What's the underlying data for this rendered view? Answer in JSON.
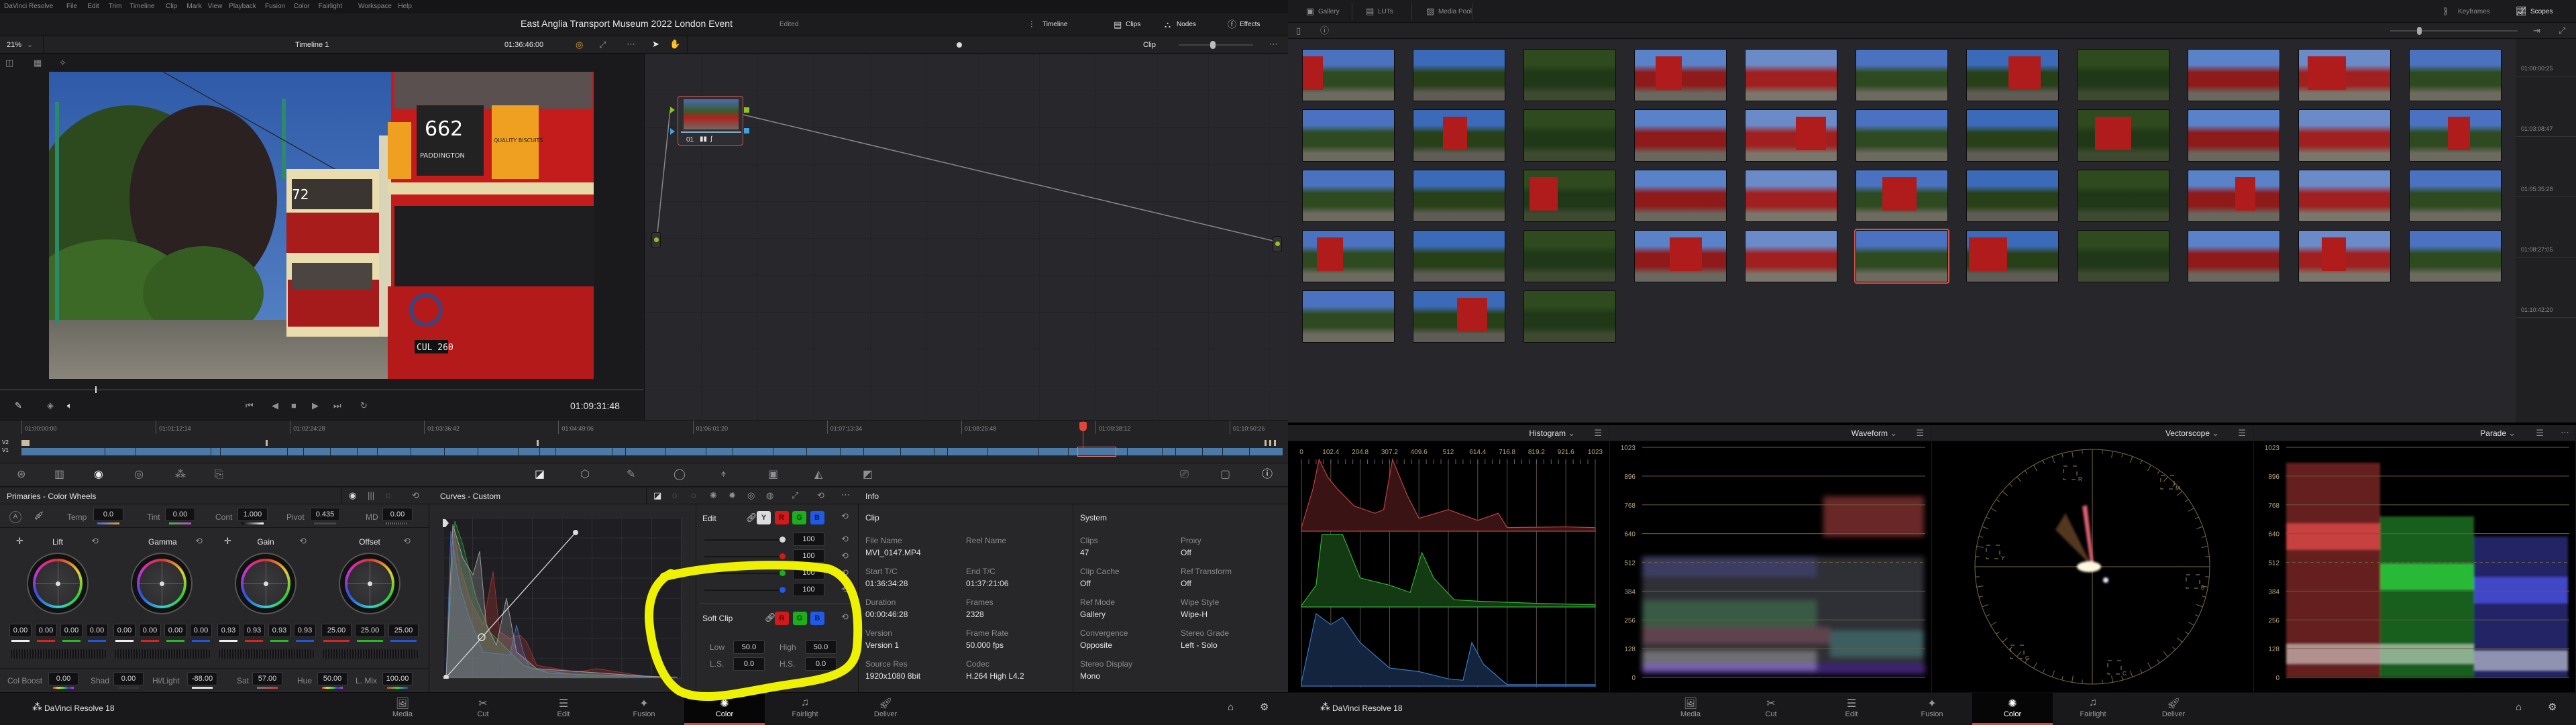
{
  "menu": [
    "DaVinci Resolve",
    "File",
    "Edit",
    "Trim",
    "Timeline",
    "Clip",
    "Mark",
    "View",
    "Playback",
    "Fusion",
    "Color",
    "Fairlight",
    "Workspace",
    "Help"
  ],
  "title": {
    "project": "East Anglia Transport Museum 2022 London Event",
    "status": "Edited"
  },
  "top_left_tabs": [
    {
      "label": "Timeline",
      "icon": "timeline-icon"
    },
    {
      "label": "Clips",
      "icon": "clips-icon"
    },
    {
      "label": "Nodes",
      "icon": "nodes-icon"
    },
    {
      "label": "Effects",
      "icon": "effects-icon"
    }
  ],
  "viewer": {
    "zoom": "21%",
    "timeline": "Timeline 1",
    "timecode": "01:36:46:00",
    "node_mode": "Clip",
    "playhead_timecode": "01:09:31:48",
    "image_text": {
      "bus_number": "662",
      "tram_number": "72",
      "plate": "CUL 260",
      "destination": "PADDINGTON",
      "ad": "QUALITY BISCUITS"
    }
  },
  "node": {
    "label": "01"
  },
  "timeline": {
    "ruler": [
      "01:00:00:00",
      "01:01:12:14",
      "01:02:24:28",
      "01:03:36:42",
      "01:04:49:06",
      "01:06:01:20",
      "01:07:13:34",
      "01:08:25:48",
      "01:09:38:12",
      "01:10:50:26"
    ],
    "tracks": [
      "V2",
      "V1"
    ],
    "playhead_color": "#e0453a",
    "clip_color": "#4b7aa6"
  },
  "primaries": {
    "title": "Primaries - Color Wheels",
    "sliders": [
      {
        "label": "Temp",
        "value": "0.0"
      },
      {
        "label": "Tint",
        "value": "0.00"
      },
      {
        "label": "Cont",
        "value": "1.000"
      },
      {
        "label": "Pivot",
        "value": "0.435"
      },
      {
        "label": "MD",
        "value": "0.00"
      }
    ],
    "wheels": [
      {
        "name": "Lift",
        "values": [
          "0.00",
          "0.00",
          "0.00",
          "0.00"
        ]
      },
      {
        "name": "Gamma",
        "values": [
          "0.00",
          "0.00",
          "0.00",
          "0.00"
        ]
      },
      {
        "name": "Gain",
        "values": [
          "0.93",
          "0.93",
          "0.93",
          "0.93"
        ]
      },
      {
        "name": "Offset",
        "values": [
          "25.00",
          "25.00",
          "25.00"
        ]
      }
    ],
    "bottom": [
      {
        "label": "Col Boost",
        "value": "0.00"
      },
      {
        "label": "Shad",
        "value": "0.00"
      },
      {
        "label": "Hi/Light",
        "value": "-88.00"
      },
      {
        "label": "Sat",
        "value": "57.00"
      },
      {
        "label": "Hue",
        "value": "50.00"
      },
      {
        "label": "L. Mix",
        "value": "100.00"
      }
    ]
  },
  "curves": {
    "title": "Curves - Custom",
    "edit_label": "Edit",
    "channels": [
      "Y",
      "R",
      "G",
      "B"
    ],
    "intensity": [
      {
        "channel": "Y",
        "value": "100",
        "color": "#d8d8d8"
      },
      {
        "channel": "R",
        "value": "100",
        "color": "#d11a1a"
      },
      {
        "channel": "G",
        "value": "100",
        "color": "#1cae1c"
      },
      {
        "channel": "B",
        "value": "100",
        "color": "#1f5be8"
      }
    ],
    "soft_clip": {
      "label": "Soft Clip",
      "channels": [
        "R",
        "G",
        "B"
      ],
      "fields": [
        {
          "label": "Low",
          "value": "50.0"
        },
        {
          "label": "High",
          "value": "50.0"
        },
        {
          "label": "L.S.",
          "value": "0.0"
        },
        {
          "label": "H.S.",
          "value": "0.0"
        }
      ]
    }
  },
  "info": {
    "title": "Info",
    "clip_heading": "Clip",
    "system_heading": "System",
    "clip": [
      {
        "label": "File Name",
        "value": "MVI_0147.MP4"
      },
      {
        "label": "Reel Name",
        "value": ""
      },
      {
        "label": "Start T/C",
        "value": "01:36:34:28"
      },
      {
        "label": "End T/C",
        "value": "01:37:21:06"
      },
      {
        "label": "Duration",
        "value": "00:00:46:28"
      },
      {
        "label": "Frames",
        "value": "2328"
      },
      {
        "label": "Version",
        "value": "Version 1"
      },
      {
        "label": "Frame Rate",
        "value": "50.000 fps"
      },
      {
        "label": "Source Res",
        "value": "1920x1080 8bit"
      },
      {
        "label": "Codec",
        "value": "H.264 High L4.2"
      }
    ],
    "system": [
      {
        "label": "Clips",
        "value": "47"
      },
      {
        "label": "Proxy",
        "value": "Off"
      },
      {
        "label": "Clip Cache",
        "value": "Off"
      },
      {
        "label": "Ref Transform",
        "value": "Off"
      },
      {
        "label": "Ref Mode",
        "value": "Gallery"
      },
      {
        "label": "Wipe Style",
        "value": "Wipe-H"
      },
      {
        "label": "Convergence",
        "value": "Opposite"
      },
      {
        "label": "Stereo Grade",
        "value": "Left - Solo"
      },
      {
        "label": "Stereo Display",
        "value": "Mono"
      }
    ]
  },
  "pages": {
    "app_name": "DaVinci Resolve 18",
    "items": [
      {
        "label": "Media",
        "icon": "media-icon"
      },
      {
        "label": "Cut",
        "icon": "cut-icon"
      },
      {
        "label": "Edit",
        "icon": "edit-icon"
      },
      {
        "label": "Fusion",
        "icon": "fusion-icon"
      },
      {
        "label": "Color",
        "icon": "color-icon"
      },
      {
        "label": "Fairlight",
        "icon": "fairlight-icon"
      },
      {
        "label": "Deliver",
        "icon": "deliver-icon"
      }
    ],
    "active": "Color"
  },
  "right_top": {
    "left": [
      {
        "label": "Gallery",
        "icon": "gallery-icon"
      },
      {
        "label": "LUTs",
        "icon": "luts-icon"
      },
      {
        "label": "Media Pool",
        "icon": "media-pool-icon"
      }
    ],
    "right": [
      {
        "label": "Keyframes",
        "icon": "keyframes-icon"
      },
      {
        "label": "Scopes",
        "icon": "scopes-icon"
      }
    ]
  },
  "gallery": {
    "clip_count": 47,
    "selected_clip": 39,
    "row_timecodes": [
      "01:00:00:25",
      "01:03:08:47",
      "01:05:35:28",
      "01:08:27:05",
      "01:10:42:20"
    ]
  },
  "scopes": {
    "histogram": {
      "title": "Histogram",
      "x_labels": [
        "0",
        "102.4",
        "204.8",
        "307.2",
        "409.6",
        "512",
        "614.4",
        "716.8",
        "819.2",
        "921.6",
        "1023"
      ]
    },
    "waveform": {
      "title": "Waveform",
      "y_labels": [
        "1023",
        "896",
        "768",
        "640",
        "512",
        "384",
        "256",
        "128",
        "0"
      ]
    },
    "vectorscope": {
      "title": "Vectorscope",
      "targets": [
        "R",
        "M",
        "B",
        "C",
        "G",
        "Y"
      ]
    },
    "parade": {
      "title": "Parade",
      "y_labels": [
        "1023",
        "896",
        "768",
        "640",
        "512",
        "384",
        "256",
        "128",
        "0"
      ]
    }
  },
  "annotation_color": "#eef200"
}
